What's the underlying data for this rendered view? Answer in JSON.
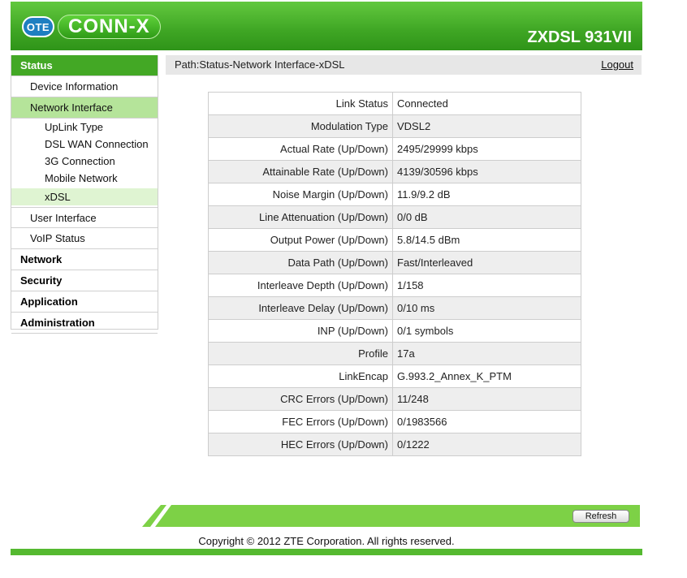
{
  "header": {
    "logo_badge": "OTE",
    "logo_text": "CONN-X",
    "model": "ZXDSL 931VII"
  },
  "sidebar": {
    "status": "Status",
    "device_information": "Device Information",
    "network_interface": "Network Interface",
    "uplink_type": "UpLink Type",
    "dsl_wan_connection": "DSL WAN Connection",
    "three_g_connection": "3G Connection",
    "mobile_network": "Mobile Network",
    "xdsl": "xDSL",
    "user_interface": "User Interface",
    "voip_status": "VoIP Status",
    "network": "Network",
    "security": "Security",
    "application": "Application",
    "administration": "Administration"
  },
  "path": {
    "text": "Path:Status-Network Interface-xDSL",
    "logout": "Logout"
  },
  "stats": [
    {
      "label": "Link Status",
      "value": "Connected"
    },
    {
      "label": "Modulation Type",
      "value": "VDSL2"
    },
    {
      "label": "Actual Rate (Up/Down)",
      "value": "2495/29999 kbps"
    },
    {
      "label": "Attainable Rate (Up/Down)",
      "value": "4139/30596 kbps"
    },
    {
      "label": "Noise Margin (Up/Down)",
      "value": "11.9/9.2 dB"
    },
    {
      "label": "Line Attenuation (Up/Down)",
      "value": "0/0 dB"
    },
    {
      "label": "Output Power (Up/Down)",
      "value": "5.8/14.5 dBm"
    },
    {
      "label": "Data Path (Up/Down)",
      "value": "Fast/Interleaved"
    },
    {
      "label": "Interleave Depth (Up/Down)",
      "value": "1/158"
    },
    {
      "label": "Interleave Delay (Up/Down)",
      "value": "0/10 ms"
    },
    {
      "label": "INP (Up/Down)",
      "value": "0/1 symbols"
    },
    {
      "label": "Profile",
      "value": "17a"
    },
    {
      "label": "LinkEncap",
      "value": "G.993.2_Annex_K_PTM"
    },
    {
      "label": "CRC Errors (Up/Down)",
      "value": "11/248"
    },
    {
      "label": "FEC Errors (Up/Down)",
      "value": "0/1983566"
    },
    {
      "label": "HEC Errors (Up/Down)",
      "value": "0/1222"
    }
  ],
  "footer": {
    "refresh_label": "Refresh",
    "copyright": "Copyright © 2012 ZTE Corporation. All rights reserved."
  },
  "colors": {
    "brand_green": "#43a825",
    "light_green": "#b5e49a",
    "footer_green": "#7dd146",
    "logo_blue": "#1e7fc1"
  }
}
